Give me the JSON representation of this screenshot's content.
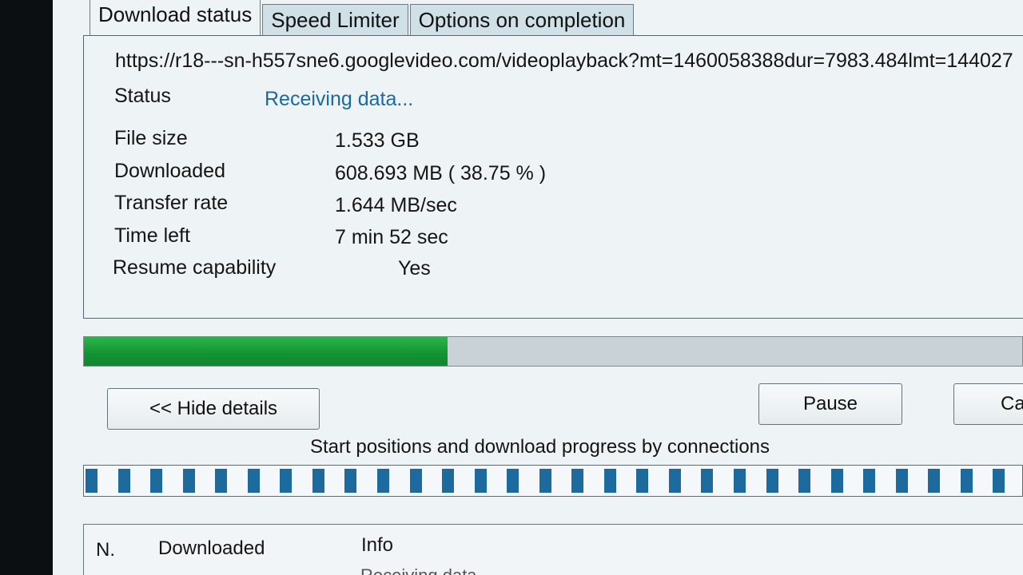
{
  "tabs": [
    {
      "label": "Download status",
      "active": true
    },
    {
      "label": "Speed Limiter",
      "active": false
    },
    {
      "label": "Options on completion",
      "active": false
    }
  ],
  "url": "https://r18---sn-h557sne6.googlevideo.com/videoplayback?mt=1460058388dur=7983.484lmt=144027",
  "status": {
    "label": "Status",
    "value": "Receiving data..."
  },
  "details": [
    {
      "label": "File size",
      "value": "1.533  GB"
    },
    {
      "label": "Downloaded",
      "value": "608.693  MB  ( 38.75 % )"
    },
    {
      "label": "Transfer rate",
      "value": "1.644  MB/sec"
    },
    {
      "label": "Time left",
      "value": "7 min 52 sec"
    },
    {
      "label": "Resume capability",
      "value": "Yes"
    }
  ],
  "progress": {
    "percent": 38.75,
    "color": "#139233"
  },
  "buttons": {
    "hide_details": "<< Hide details",
    "pause": "Pause",
    "cancel": "Cancel"
  },
  "connections": {
    "title": "Start positions and download progress by connections",
    "count": 29,
    "bar_color": "#1d6a9f"
  },
  "table": {
    "headers": [
      "N.",
      "Downloaded",
      "Info"
    ],
    "partial_row_info": "Receiving data..."
  }
}
